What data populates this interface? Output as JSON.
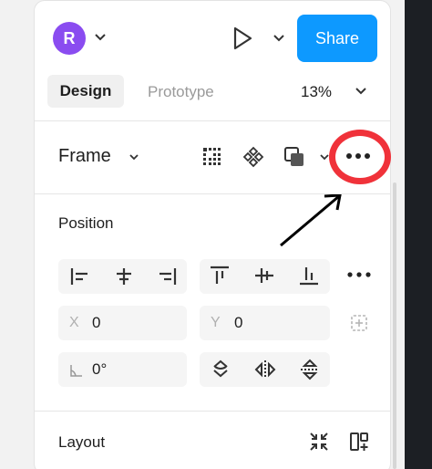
{
  "header": {
    "avatar_initial": "R",
    "share_label": "Share"
  },
  "tabs": {
    "design_label": "Design",
    "prototype_label": "Prototype",
    "zoom_value": "13%"
  },
  "frame_row": {
    "frame_label": "Frame",
    "icons": [
      "grid-icon",
      "component-icon",
      "boolean-icon",
      "more-icon"
    ]
  },
  "position": {
    "title": "Position",
    "x_label": "X",
    "x_value": "0",
    "y_label": "Y",
    "y_value": "0",
    "rotation_value": "0°"
  },
  "layout": {
    "title": "Layout"
  },
  "annotation": {
    "highlight_color": "#f0323a"
  },
  "colors": {
    "accent": "#0d99ff",
    "avatar": "#8a4cf0"
  }
}
